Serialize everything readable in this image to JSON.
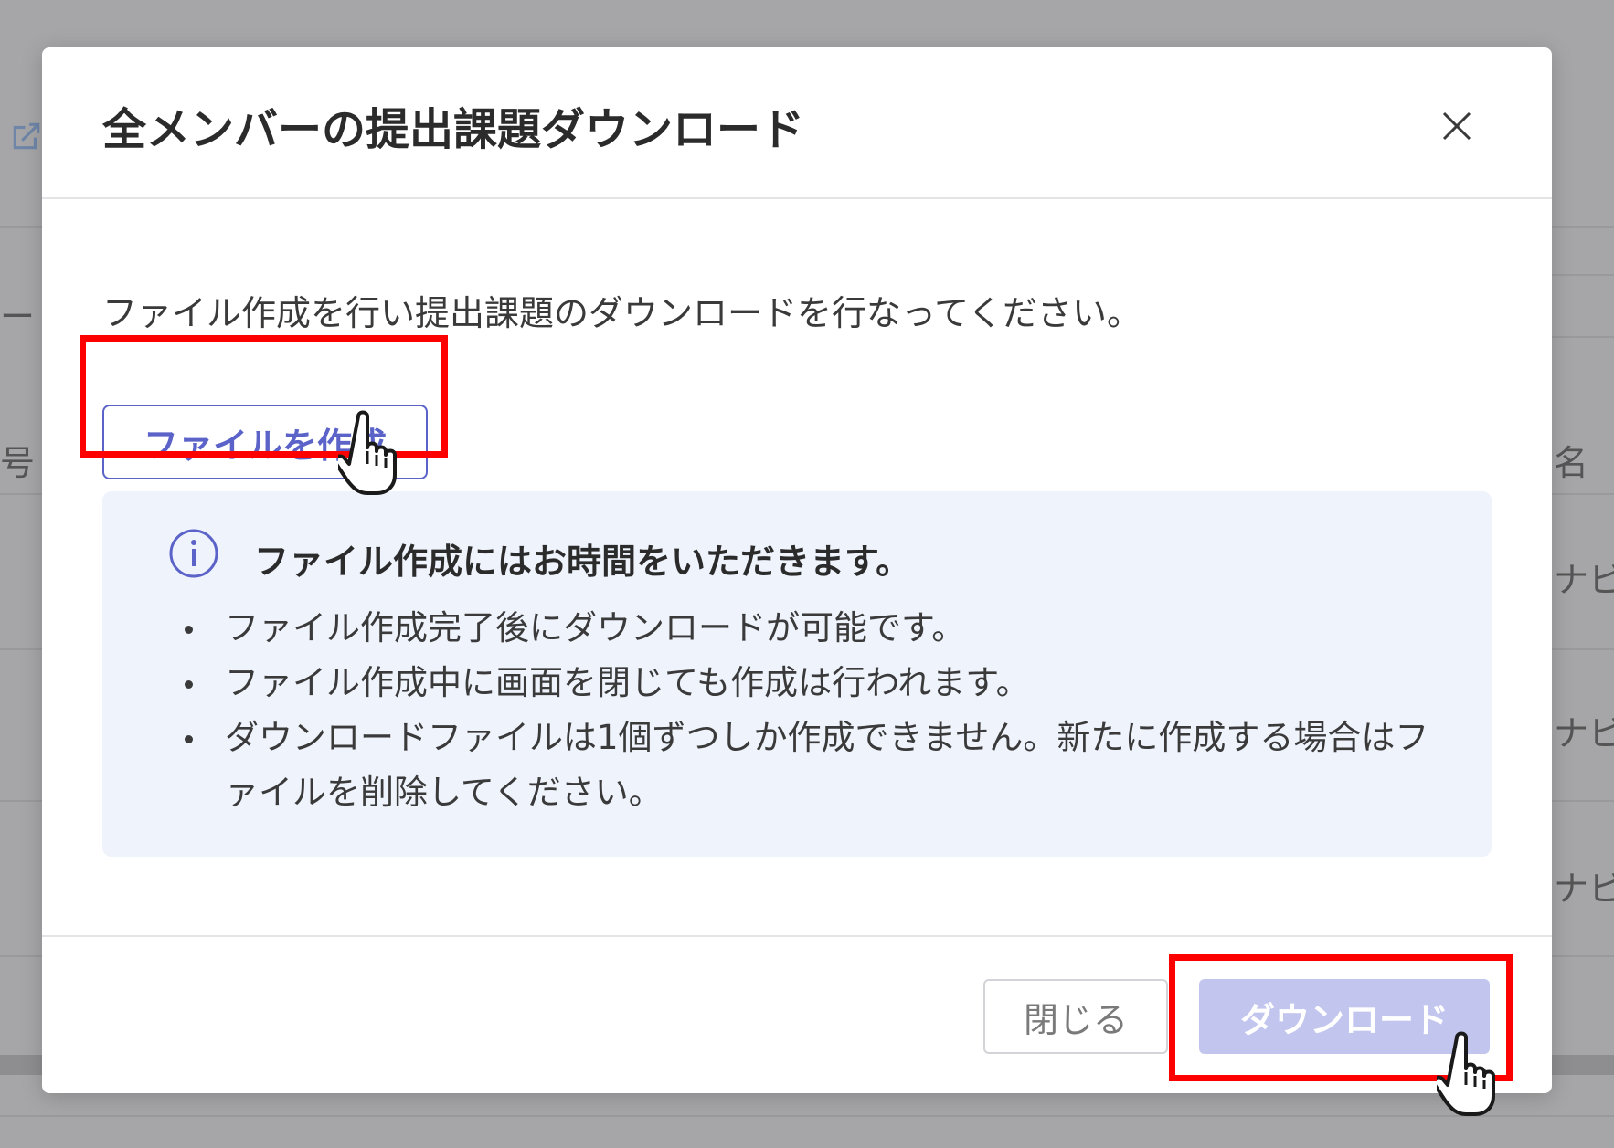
{
  "background": {
    "fragments": [
      "ー",
      "号",
      "名",
      "ナビ",
      "ナビ",
      "ナビ"
    ]
  },
  "dialog": {
    "title": "全メンバーの提出課題ダウンロード",
    "close_icon": "close-icon",
    "intro": "ファイル作成を行い提出課題のダウンロードを行なってください。",
    "create_button": "ファイルを作成",
    "info": {
      "icon": "info-circle-icon",
      "heading": "ファイル作成にはお時間をいただきます。",
      "items": [
        "ファイル作成完了後にダウンロードが可能です。",
        "ファイル作成中に画面を閉じても作成は行われます。",
        "ダウンロードファイルは1個ずつしか作成できません。新たに作成する場合はファイルを削除してください。"
      ]
    },
    "footer": {
      "close_button": "閉じる",
      "download_button": "ダウンロード",
      "download_disabled": true
    }
  },
  "colors": {
    "accent": "#5b63c9",
    "download_disabled_bg": "#c2c6ee",
    "info_bg": "#eff3fc",
    "highlight": "#ff0000"
  }
}
